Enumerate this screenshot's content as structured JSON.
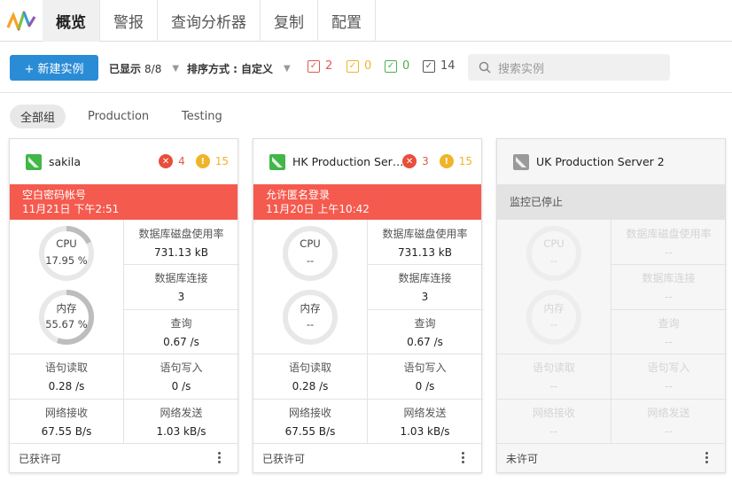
{
  "nav": {
    "tabs": [
      {
        "label": "概览",
        "active": true
      },
      {
        "label": "警报"
      },
      {
        "label": "查询分析器"
      },
      {
        "label": "复制"
      },
      {
        "label": "配置"
      }
    ]
  },
  "toolbar": {
    "new_instance": "+ 新建实例",
    "shown_label": "已显示",
    "shown_value": "8/8",
    "sort_label": "排序方式 :",
    "sort_value": "自定义",
    "counts": [
      {
        "value": "2",
        "color": "#e05a4e"
      },
      {
        "value": "0",
        "color": "#f0b429"
      },
      {
        "value": "0",
        "color": "#4caf50"
      },
      {
        "value": "14",
        "color": "#555555"
      }
    ],
    "search_placeholder": "搜索实例"
  },
  "groups": [
    "全部组",
    "Production",
    "Testing"
  ],
  "cards": [
    {
      "name": "sakila",
      "icon_color": "#43b649",
      "errors": "4",
      "warnings": "15",
      "alert_title": "空白密码帐号",
      "alert_time": "11月21日 下午2:51",
      "cpu_label": "CPU",
      "cpu_value": "17.95 %",
      "cpu_pct": 0.1795,
      "mem_label": "内存",
      "mem_value": "55.67 %",
      "mem_pct": 0.5567,
      "disk_label": "数据库磁盘使用率",
      "disk_value": "731.13 kB",
      "conn_label": "数据库连接",
      "conn_value": "3",
      "query_label": "查询",
      "query_value": "0.67 /s",
      "read_label": "语句读取",
      "read_value": "0.28 /s",
      "write_label": "语句写入",
      "write_value": "0 /s",
      "recv_label": "网络接收",
      "recv_value": "67.55 B/s",
      "send_label": "网络发送",
      "send_value": "1.03 kB/s",
      "license": "已获许可"
    },
    {
      "name": "HK Production Serve...",
      "icon_color": "#43b649",
      "errors": "3",
      "warnings": "15",
      "alert_title": "允许匿名登录",
      "alert_time": "11月20日 上午10:42",
      "cpu_label": "CPU",
      "cpu_value": "--",
      "mem_label": "内存",
      "mem_value": "--",
      "disk_label": "数据库磁盘使用率",
      "disk_value": "731.13 kB",
      "conn_label": "数据库连接",
      "conn_value": "3",
      "query_label": "查询",
      "query_value": "0.67 /s",
      "read_label": "语句读取",
      "read_value": "0.28 /s",
      "write_label": "语句写入",
      "write_value": "0 /s",
      "recv_label": "网络接收",
      "recv_value": "67.55 B/s",
      "send_label": "网络发送",
      "send_value": "1.03 kB/s",
      "license": "已获许可"
    },
    {
      "name": "UK Production Server 2",
      "icon_color": "#9a9a9a",
      "alert_title": "监控已停止",
      "cpu_label": "CPU",
      "cpu_value": "--",
      "mem_label": "内存",
      "mem_value": "--",
      "disk_label": "数据库磁盘使用率",
      "disk_value": "--",
      "conn_label": "数据库连接",
      "conn_value": "--",
      "query_label": "查询",
      "query_value": "--",
      "read_label": "语句读取",
      "read_value": "--",
      "write_label": "语句写入",
      "write_value": "--",
      "recv_label": "网络接收",
      "recv_value": "--",
      "send_label": "网络发送",
      "send_value": "--",
      "license": "未许可"
    }
  ]
}
